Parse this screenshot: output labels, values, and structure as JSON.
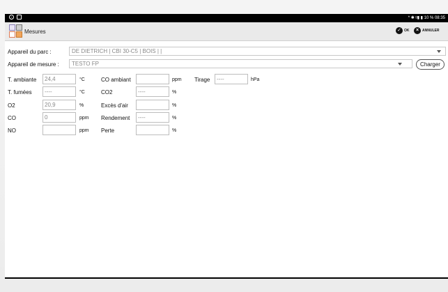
{
  "statusbar": {
    "right_text": "* ✱ ᵍ▮ ▮ 10 % 08:35"
  },
  "toolbar": {
    "title": "Mesures",
    "ok_label": "OK",
    "cancel_label": "ANNULER"
  },
  "parc": {
    "label": "Appareil du parc :",
    "value": "DE DIETRICH | CBI 30-C5  | BOIS  |  |"
  },
  "mesure": {
    "label": "Appareil de mesure :",
    "value": "TESTO FP",
    "charger_label": "Charger"
  },
  "fields": {
    "t_ambiante": {
      "label": "T. ambiante",
      "value": "24,4",
      "unit": "°C"
    },
    "t_fumees": {
      "label": "T. fumées",
      "value": "----",
      "unit": "°C"
    },
    "o2": {
      "label": "O2",
      "value": "20,9",
      "unit": "%"
    },
    "co": {
      "label": "CO",
      "value": "0",
      "unit": "ppm"
    },
    "no": {
      "label": "NO",
      "value": "",
      "unit": "ppm"
    },
    "co_ambiant": {
      "label": "CO ambiant",
      "value": "",
      "unit": "ppm"
    },
    "co2": {
      "label": "CO2",
      "value": "----",
      "unit": "%"
    },
    "exces_air": {
      "label": "Excès d'air",
      "value": "",
      "unit": "%"
    },
    "rendement": {
      "label": "Rendement",
      "value": "----",
      "unit": "%"
    },
    "perte": {
      "label": "Perte",
      "value": "",
      "unit": "%"
    },
    "tirage": {
      "label": "Tirage",
      "value": "----",
      "unit": "hPa"
    }
  }
}
